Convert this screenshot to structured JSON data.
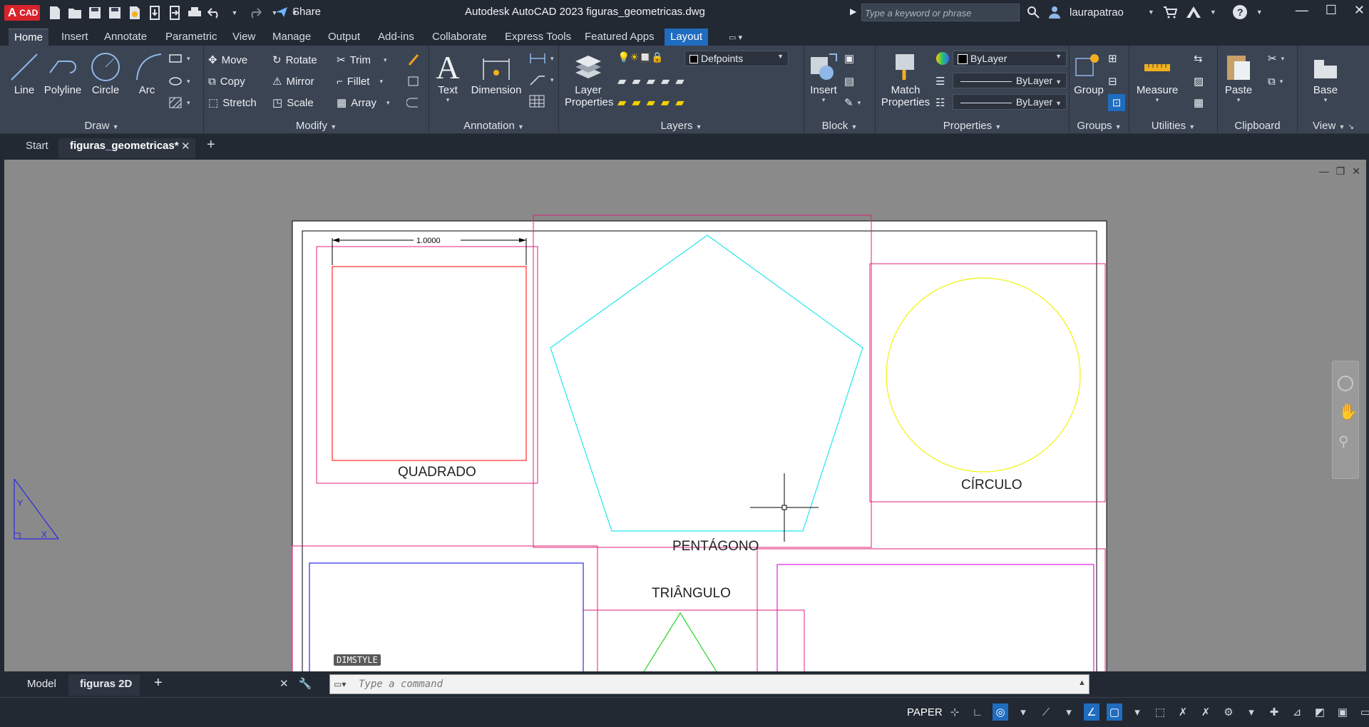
{
  "titlebar": {
    "logo_main": "A",
    "logo_sub": "CAD",
    "share_label": "Share",
    "app_title": "Autodesk AutoCAD 2023    figuras_geometricas.dwg",
    "search_placeholder": "Type a keyword or phrase",
    "username": "laurapatrao"
  },
  "ribbon_tabs": [
    "Home",
    "Insert",
    "Annotate",
    "Parametric",
    "View",
    "Manage",
    "Output",
    "Add-ins",
    "Collaborate",
    "Express Tools",
    "Featured Apps",
    "Layout"
  ],
  "ribbon": {
    "draw": {
      "title": "Draw",
      "line": "Line",
      "polyline": "Polyline",
      "circle": "Circle",
      "arc": "Arc"
    },
    "modify": {
      "title": "Modify",
      "move": "Move",
      "rotate": "Rotate",
      "trim": "Trim",
      "copy": "Copy",
      "mirror": "Mirror",
      "fillet": "Fillet",
      "stretch": "Stretch",
      "scale": "Scale",
      "array": "Array"
    },
    "annotation": {
      "title": "Annotation",
      "text": "Text",
      "dimension": "Dimension"
    },
    "layers": {
      "title": "Layers",
      "layer_properties_1": "Layer",
      "layer_properties_2": "Properties",
      "current_layer": "Defpoints"
    },
    "block": {
      "title": "Block",
      "insert": "Insert"
    },
    "properties": {
      "title": "Properties",
      "match_1": "Match",
      "match_2": "Properties",
      "color": "ByLayer",
      "linetype": "ByLayer",
      "lineweight": "ByLayer"
    },
    "groups": {
      "title": "Groups",
      "group": "Group"
    },
    "utilities": {
      "title": "Utilities",
      "measure": "Measure"
    },
    "clipboard": {
      "title": "Clipboard",
      "paste": "Paste"
    },
    "view": {
      "title": "View",
      "base": "Base"
    }
  },
  "doc_tabs": {
    "start": "Start",
    "active": "figuras_geometricas*"
  },
  "drawing": {
    "dimension": "1.0000",
    "labels": {
      "square": "QUADRADO",
      "pentagon": "PENTÁGONO",
      "circle": "CÍRCULO",
      "triangle": "TRIÂNGULO"
    },
    "tooltip": "DIMSTYLE",
    "colors": {
      "square": "#ff2a2a",
      "pentagon": "#22e6f0",
      "circle": "#f2f20a",
      "triangle": "#22d622",
      "viewport": "#e0207a",
      "blue_rect": "#2a2ae6",
      "magenta_rect": "#e020e0"
    }
  },
  "layout_tabs": {
    "model": "Model",
    "active": "figuras 2D"
  },
  "command": {
    "placeholder": "Type a command"
  },
  "status": {
    "space": "PAPER"
  }
}
